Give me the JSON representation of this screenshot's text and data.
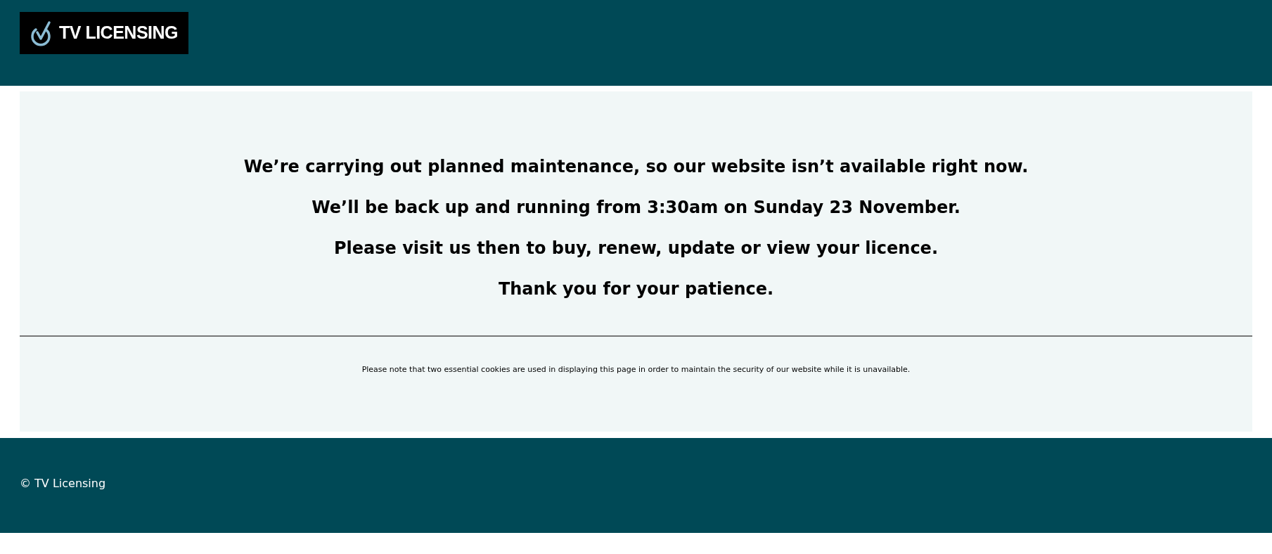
{
  "header": {
    "logo_text": "TV LICENSING"
  },
  "message": [
    "We’re carrying out planned maintenance, so our website isn’t available right now.",
    "We’ll be back up and running from 3:30am on Sunday 23 November.",
    "Please visit us then to buy, renew, update or view your licence.",
    "Thank you for your patience."
  ],
  "note": "Please note that two essential cookies are used in displaying this page in order to maintain the security of our website while it is unavailable.",
  "footer": {
    "copyright": "© TV Licensing"
  }
}
